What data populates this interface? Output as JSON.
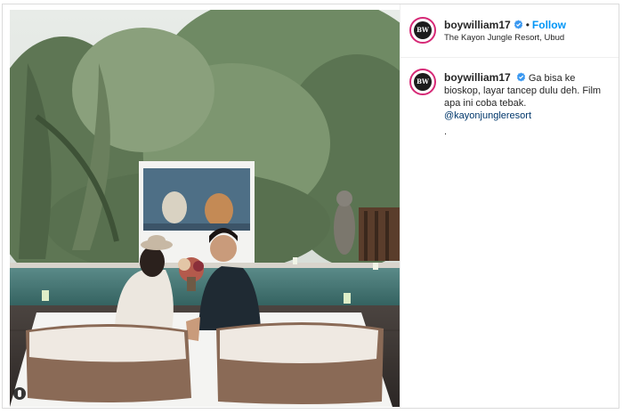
{
  "post": {
    "username": "boywilliam17",
    "follow_label": "Follow",
    "separator": "•",
    "location": "The Kayon Jungle Resort, Ubud",
    "avatar_text": "BW",
    "caption": {
      "username": "boywilliam17",
      "text_part1": "Ga bisa ke bioskop, layar tancep dulu deh. Film apa ini coba tebak. ",
      "mention": "@kayonjungleresort",
      "trailing": "."
    }
  },
  "colors": {
    "follow": "#0095f6",
    "verified": "#3897f0",
    "mention": "#00376b"
  },
  "icons": {
    "verified": "verified-badge-icon",
    "photo_corner": "user-tag-icon"
  }
}
